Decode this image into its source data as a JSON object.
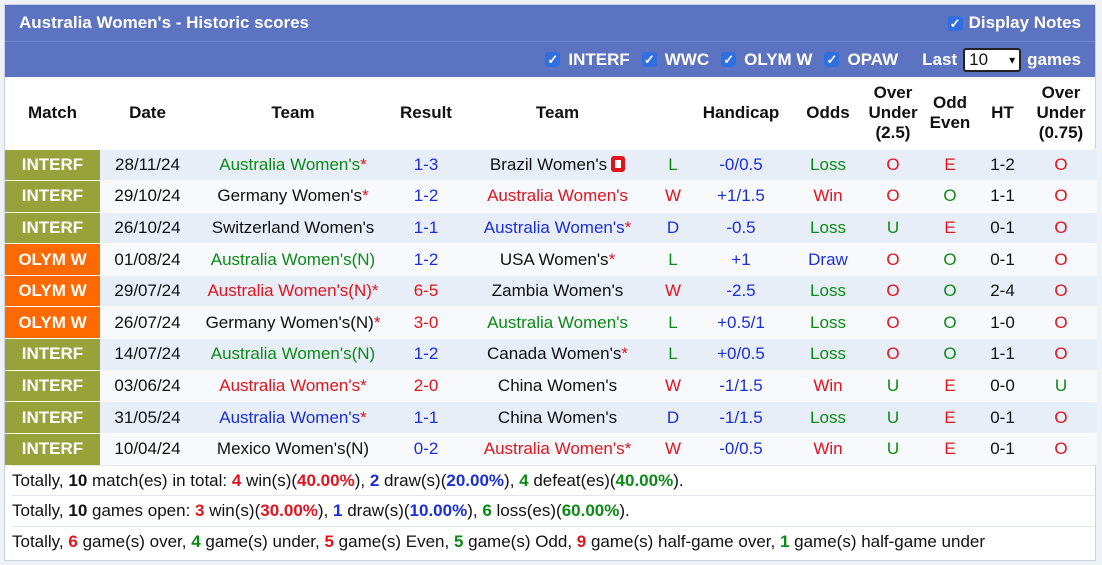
{
  "header": {
    "title": "Australia Women's - Historic scores",
    "display_notes_label": "Display Notes",
    "filters": [
      "INTERF",
      "WWC",
      "OLYM W",
      "OPAW"
    ],
    "last_label": "Last",
    "last_value": "10",
    "games_label": "games"
  },
  "columns": {
    "match": "Match",
    "date": "Date",
    "team1": "Team",
    "result": "Result",
    "team2": "Team",
    "handicap": "Handicap",
    "odds": "Odds",
    "ou1": "Over",
    "ou2": "Under",
    "ou3": "(2.5)",
    "oe1": "Odd",
    "oe2": "Even",
    "ht": "HT",
    "ou75_1": "Over",
    "ou75_2": "Under",
    "ou75_3": "(0.75)"
  },
  "rows": [
    {
      "comp": "INTERF",
      "type": "interf",
      "date": "28/11/24",
      "home": "Australia Women's",
      "homeStar": "*",
      "homeColor": "green",
      "result": "1-3",
      "resColor": "blue",
      "away": "Brazil Women's",
      "awayStar": "",
      "awayColor": "black",
      "redcard": true,
      "wdl": "L",
      "wdlColor": "green",
      "hcp": "-0/0.5",
      "odds": "Loss",
      "oddsColor": "green",
      "ou": "O",
      "ouColor": "red",
      "oe": "E",
      "oeColor": "red",
      "ht": "1-2",
      "ou75": "O",
      "ou75Color": "red"
    },
    {
      "comp": "INTERF",
      "type": "interf",
      "date": "29/10/24",
      "home": "Germany Women's",
      "homeStar": "*",
      "homeColor": "black",
      "result": "1-2",
      "resColor": "blue",
      "away": "Australia Women's",
      "awayStar": "",
      "awayColor": "red",
      "redcard": false,
      "wdl": "W",
      "wdlColor": "red",
      "hcp": "+1/1.5",
      "odds": "Win",
      "oddsColor": "red",
      "ou": "O",
      "ouColor": "red",
      "oe": "O",
      "oeColor": "green",
      "ht": "1-1",
      "ou75": "O",
      "ou75Color": "red"
    },
    {
      "comp": "INTERF",
      "type": "interf",
      "date": "26/10/24",
      "home": "Switzerland Women's",
      "homeStar": "",
      "homeColor": "black",
      "result": "1-1",
      "resColor": "blue",
      "away": "Australia Women's",
      "awayStar": "*",
      "awayColor": "blue",
      "redcard": false,
      "wdl": "D",
      "wdlColor": "blue",
      "hcp": "-0.5",
      "odds": "Loss",
      "oddsColor": "green",
      "ou": "U",
      "ouColor": "green",
      "oe": "E",
      "oeColor": "red",
      "ht": "0-1",
      "ou75": "O",
      "ou75Color": "red"
    },
    {
      "comp": "OLYM W",
      "type": "olym",
      "date": "01/08/24",
      "home": "Australia Women's(N)",
      "homeStar": "",
      "homeColor": "green",
      "result": "1-2",
      "resColor": "blue",
      "away": "USA Women's",
      "awayStar": "*",
      "awayColor": "black",
      "redcard": false,
      "wdl": "L",
      "wdlColor": "green",
      "hcp": "+1",
      "odds": "Draw",
      "oddsColor": "blue",
      "ou": "O",
      "ouColor": "red",
      "oe": "O",
      "oeColor": "green",
      "ht": "0-1",
      "ou75": "O",
      "ou75Color": "red"
    },
    {
      "comp": "OLYM W",
      "type": "olym",
      "date": "29/07/24",
      "home": "Australia Women's(N)",
      "homeStar": "*",
      "homeColor": "red",
      "result": "6-5",
      "resColor": "red",
      "away": "Zambia Women's",
      "awayStar": "",
      "awayColor": "black",
      "redcard": false,
      "wdl": "W",
      "wdlColor": "red",
      "hcp": "-2.5",
      "odds": "Loss",
      "oddsColor": "green",
      "ou": "O",
      "ouColor": "red",
      "oe": "O",
      "oeColor": "green",
      "ht": "2-4",
      "ou75": "O",
      "ou75Color": "red"
    },
    {
      "comp": "OLYM W",
      "type": "olym",
      "date": "26/07/24",
      "home": "Germany Women's(N)",
      "homeStar": "*",
      "homeColor": "black",
      "result": "3-0",
      "resColor": "red",
      "away": "Australia Women's",
      "awayStar": "",
      "awayColor": "green",
      "redcard": false,
      "wdl": "L",
      "wdlColor": "green",
      "hcp": "+0.5/1",
      "odds": "Loss",
      "oddsColor": "green",
      "ou": "O",
      "ouColor": "red",
      "oe": "O",
      "oeColor": "green",
      "ht": "1-0",
      "ou75": "O",
      "ou75Color": "red"
    },
    {
      "comp": "INTERF",
      "type": "interf",
      "date": "14/07/24",
      "home": "Australia Women's(N)",
      "homeStar": "",
      "homeColor": "green",
      "result": "1-2",
      "resColor": "blue",
      "away": "Canada Women's",
      "awayStar": "*",
      "awayColor": "black",
      "redcard": false,
      "wdl": "L",
      "wdlColor": "green",
      "hcp": "+0/0.5",
      "odds": "Loss",
      "oddsColor": "green",
      "ou": "O",
      "ouColor": "red",
      "oe": "O",
      "oeColor": "green",
      "ht": "1-1",
      "ou75": "O",
      "ou75Color": "red"
    },
    {
      "comp": "INTERF",
      "type": "interf",
      "date": "03/06/24",
      "home": "Australia Women's",
      "homeStar": "*",
      "homeColor": "red",
      "result": "2-0",
      "resColor": "red",
      "away": "China Women's",
      "awayStar": "",
      "awayColor": "black",
      "redcard": false,
      "wdl": "W",
      "wdlColor": "red",
      "hcp": "-1/1.5",
      "odds": "Win",
      "oddsColor": "red",
      "ou": "U",
      "ouColor": "green",
      "oe": "E",
      "oeColor": "red",
      "ht": "0-0",
      "ou75": "U",
      "ou75Color": "green"
    },
    {
      "comp": "INTERF",
      "type": "interf",
      "date": "31/05/24",
      "home": "Australia Women's",
      "homeStar": "*",
      "homeColor": "blue",
      "result": "1-1",
      "resColor": "blue",
      "away": "China Women's",
      "awayStar": "",
      "awayColor": "black",
      "redcard": false,
      "wdl": "D",
      "wdlColor": "blue",
      "hcp": "-1/1.5",
      "odds": "Loss",
      "oddsColor": "green",
      "ou": "U",
      "ouColor": "green",
      "oe": "E",
      "oeColor": "red",
      "ht": "0-1",
      "ou75": "O",
      "ou75Color": "red"
    },
    {
      "comp": "INTERF",
      "type": "interf",
      "date": "10/04/24",
      "home": "Mexico Women's(N)",
      "homeStar": "",
      "homeColor": "black",
      "result": "0-2",
      "resColor": "blue",
      "away": "Australia Women's",
      "awayStar": "*",
      "awayColor": "red",
      "redcard": false,
      "wdl": "W",
      "wdlColor": "red",
      "hcp": "-0/0.5",
      "odds": "Win",
      "oddsColor": "red",
      "ou": "U",
      "ouColor": "green",
      "oe": "E",
      "oeColor": "red",
      "ht": "0-1",
      "ou75": "O",
      "ou75Color": "red"
    }
  ],
  "summary": {
    "line1": {
      "pre": "Totally, ",
      "total": "10",
      "a": " match(es) in total: ",
      "wins": "4",
      "b": " win(s)(",
      "winPct": "40.00%",
      "c": "), ",
      "draws": "2",
      "d": " draw(s)(",
      "drawPct": "20.00%",
      "e": "), ",
      "defeats": "4",
      "f": " defeat(es)(",
      "defeatPct": "40.00%",
      "g": ")."
    },
    "line2": {
      "pre": "Totally, ",
      "total": "10",
      "a": " games open: ",
      "wins": "3",
      "b": " win(s)(",
      "winPct": "30.00%",
      "c": "), ",
      "draws": "1",
      "d": " draw(s)(",
      "drawPct": "10.00%",
      "e": "), ",
      "loss": "6",
      "f": " loss(es)(",
      "lossPct": "60.00%",
      "g": ")."
    },
    "line3": {
      "pre": "Totally, ",
      "over": "6",
      "a": " game(s) over, ",
      "under": "4",
      "b": " game(s) under, ",
      "even": "5",
      "c": " game(s) Even, ",
      "odd": "5",
      "d": " game(s) Odd, ",
      "hgo": "9",
      "e": " game(s) half-game over, ",
      "hgu": "1",
      "f": " game(s) half-game under"
    }
  }
}
